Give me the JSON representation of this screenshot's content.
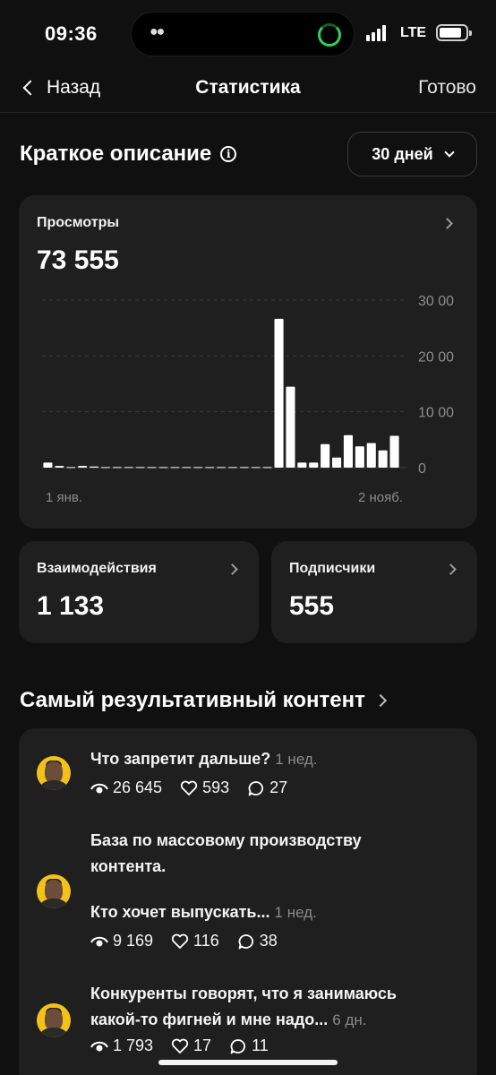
{
  "status_bar": {
    "time": "09:36",
    "network": "LTE"
  },
  "nav": {
    "back_label": "Назад",
    "title": "Статистика",
    "done_label": "Готово"
  },
  "summary": {
    "title": "Краткое описание",
    "period": "30 дней"
  },
  "views_card": {
    "label": "Просмотры",
    "value": "73 555"
  },
  "chart_data": {
    "type": "bar",
    "y_ticks": [
      "30 00",
      "20 00",
      "10 00",
      "0"
    ],
    "x_labels": [
      "1 янв.",
      "2 нояб."
    ],
    "ylim": [
      0,
      30000
    ],
    "grid": true,
    "values": [
      900,
      300,
      100,
      300,
      200,
      100,
      100,
      100,
      100,
      100,
      100,
      100,
      100,
      100,
      100,
      100,
      100,
      100,
      100,
      100,
      26645,
      14500,
      900,
      900,
      4200,
      1800,
      5800,
      3800,
      4400,
      3100,
      5700
    ]
  },
  "interactions_card": {
    "label": "Взаимодействия",
    "value": "1 133"
  },
  "followers_card": {
    "label": "Подписчики",
    "value": "555"
  },
  "top_content": {
    "title": "Самый результативный контент",
    "posts": [
      {
        "text": "Что запретит дальше?",
        "age": "1 нед.",
        "views": "26 645",
        "likes": "593",
        "comments": "27"
      },
      {
        "text_line1": "База по массовому производству",
        "text_line2": "контента.",
        "text_line3": "Кто хочет выпускать...",
        "age": "1 нед.",
        "views": "9 169",
        "likes": "116",
        "comments": "38"
      },
      {
        "text_line1": "Конкуренты говорят, что я занимаюсь",
        "text_line2": "какой-то фигней и мне надо...",
        "age": "6 дн.",
        "views": "1 793",
        "likes": "17",
        "comments": "11"
      }
    ]
  }
}
